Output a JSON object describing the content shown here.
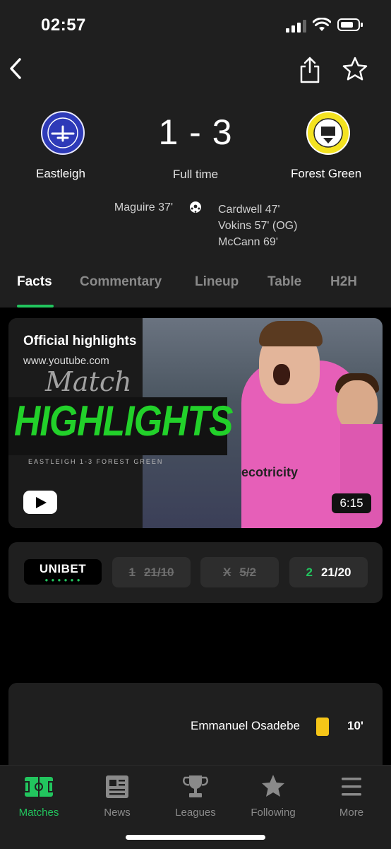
{
  "status_bar": {
    "time": "02:57"
  },
  "match": {
    "home": {
      "name": "Eastleigh"
    },
    "away": {
      "name": "Forest Green"
    },
    "score": "1 - 3",
    "status": "Full time",
    "home_scorers": [
      "Maguire 37'"
    ],
    "away_scorers": [
      "Cardwell 47'",
      "Vokins 57' (OG)",
      "McCann 69'"
    ]
  },
  "tabs": [
    "Facts",
    "Commentary",
    "Lineup",
    "Table",
    "H2H"
  ],
  "highlights": {
    "title": "Official highlights",
    "url": "www.youtube.com",
    "thumb_script": "Match",
    "thumb_big": "HIGHLIGHTS",
    "thumb_small": "EASTLEIGH 1-3 FOREST GREEN",
    "thumb_sponsor": "ecotricity",
    "duration": "6:15"
  },
  "odds": {
    "bookmaker": "UNIBET",
    "home": {
      "label": "1",
      "value": "21/10"
    },
    "draw": {
      "label": "X",
      "value": "5/2"
    },
    "away": {
      "label": "2",
      "value": "21/20"
    }
  },
  "events": [
    {
      "player": "Emmanuel Osadebe",
      "card": "yellow",
      "minute": "10'"
    }
  ],
  "bottom_nav": {
    "items": [
      {
        "label": "Matches",
        "icon": "pitch-icon",
        "active": true
      },
      {
        "label": "News",
        "icon": "newspaper-icon"
      },
      {
        "label": "Leagues",
        "icon": "trophy-icon"
      },
      {
        "label": "Following",
        "icon": "star-icon"
      },
      {
        "label": "More",
        "icon": "menu-icon"
      }
    ]
  },
  "colors": {
    "accent": "#22c55e",
    "yellow_card": "#f5c518",
    "background": "#000000",
    "surface": "#1f1f1f"
  }
}
